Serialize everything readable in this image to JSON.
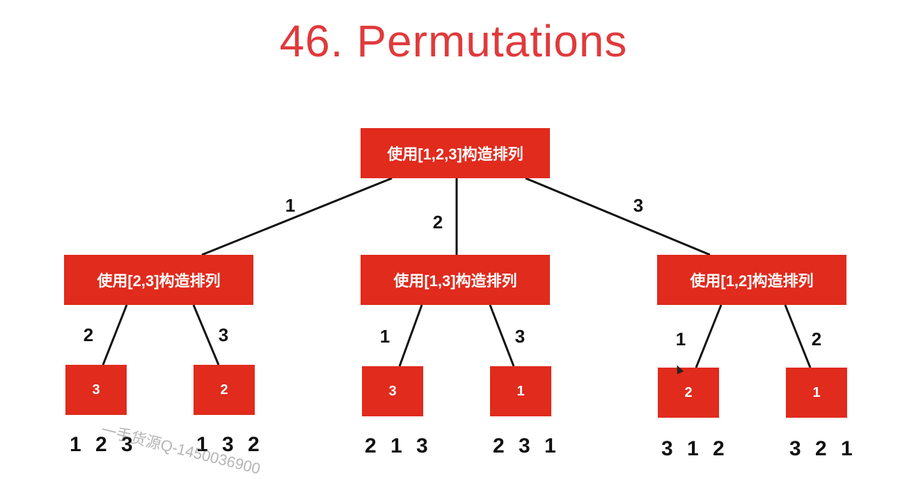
{
  "title": "46. Permutations",
  "root": {
    "label": "使用[1,2,3]构造排列"
  },
  "level1": [
    {
      "edge": "1",
      "label": "使用[2,3]构造排列"
    },
    {
      "edge": "2",
      "label": "使用[1,3]构造排列"
    },
    {
      "edge": "3",
      "label": "使用[1,2]构造排列"
    }
  ],
  "level2": [
    {
      "edge": "2",
      "label": "3",
      "result": "1 2 3"
    },
    {
      "edge": "3",
      "label": "2",
      "result": "1 3 2"
    },
    {
      "edge": "1",
      "label": "3",
      "result": "2 1 3"
    },
    {
      "edge": "3",
      "label": "1",
      "result": "2 3 1"
    },
    {
      "edge": "1",
      "label": "2",
      "result": "3 1 2"
    },
    {
      "edge": "2",
      "label": "1",
      "result": "3 2 1"
    }
  ],
  "watermark": "一手货源Q-1450036900",
  "colors": {
    "title": "#e03a3c",
    "node": "#e02b1d",
    "edge": "#111111"
  }
}
